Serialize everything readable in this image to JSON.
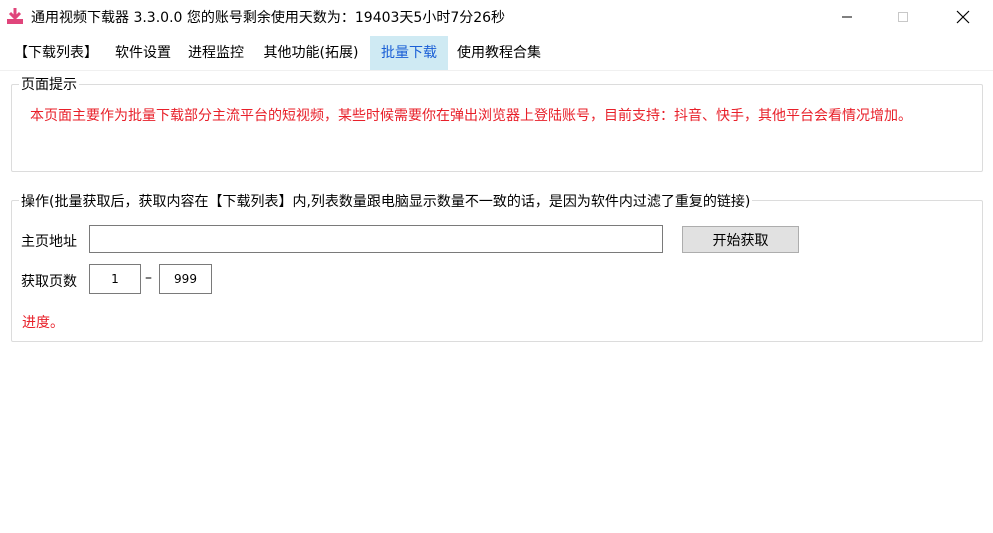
{
  "window": {
    "title": "通用视频下载器  3.3.0.0  您的账号剩余使用天数为：19403天5小时7分26秒",
    "icon": "download-app-icon",
    "accent_color": "#e0457b"
  },
  "tabs": [
    {
      "label": "【下载列表】",
      "active": false
    },
    {
      "label": "软件设置",
      "active": false
    },
    {
      "label": "进程监控",
      "active": false
    },
    {
      "label": "其他功能(拓展)",
      "active": false
    },
    {
      "label": "批量下载",
      "active": true
    },
    {
      "label": "使用教程合集",
      "active": false
    }
  ],
  "notice": {
    "title": "页面提示",
    "text": "本页面主要作为批量下载部分主流平台的短视频，某些时候需要你在弹出浏览器上登陆账号，目前支持：抖音、快手，其他平台会看情况增加。",
    "color": "#e8202a"
  },
  "operation": {
    "title": "操作(批量获取后，获取内容在【下载列表】内,列表数量跟电脑显示数量不一致的话，是因为软件内过滤了重复的链接)",
    "homepage_label": "主页地址",
    "homepage_value": "",
    "start_button": "开始获取",
    "pages_label": "获取页数",
    "page_from": "1",
    "page_separator": "–",
    "page_to": "999",
    "progress_text": "进度。"
  }
}
